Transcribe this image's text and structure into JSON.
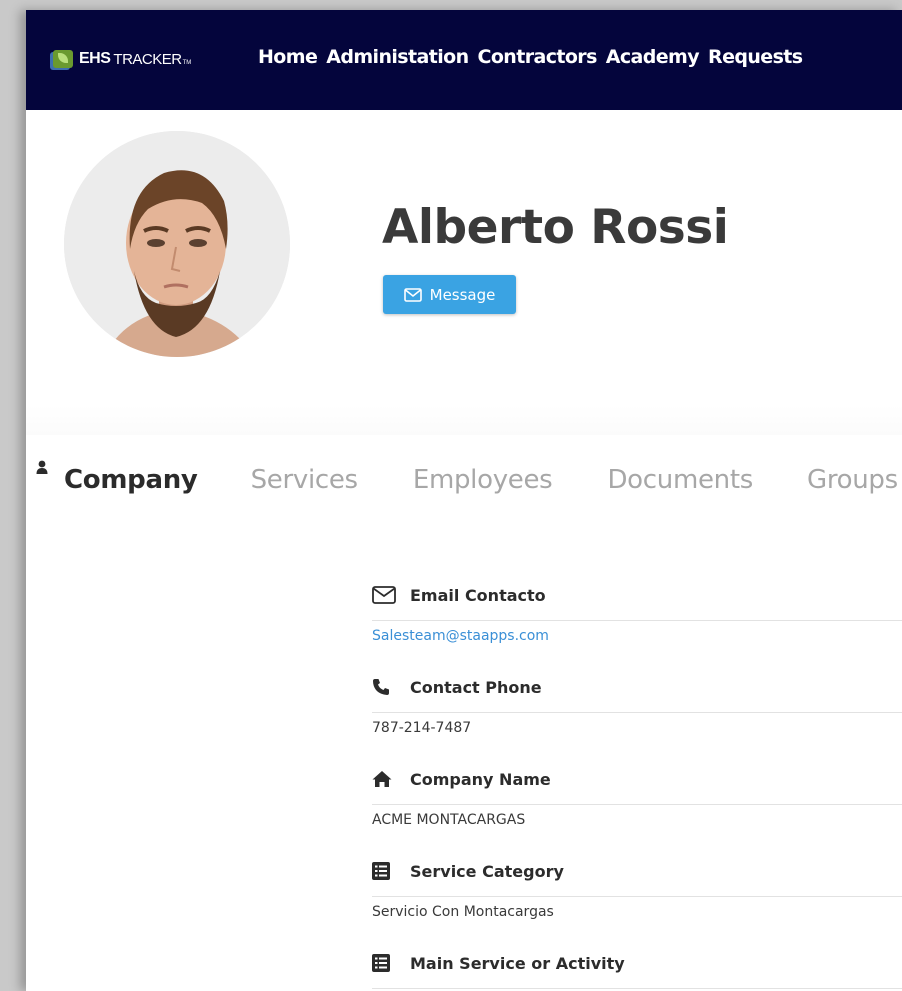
{
  "brand": {
    "ehs": "EHS",
    "tracker": "TRACKER",
    "tm": "TM"
  },
  "nav": [
    "Home",
    "Administation",
    "Contractors",
    "Academy",
    "Requests"
  ],
  "profile": {
    "name": "Alberto Rossi",
    "message_label": "Message"
  },
  "tabs": [
    "Company",
    "Services",
    "Employees",
    "Documents",
    "Groups"
  ],
  "fields": [
    {
      "icon": "envelope-icon",
      "label": "Email Contacto",
      "value": "Salesteam@staapps.com",
      "is_link": true
    },
    {
      "icon": "phone-icon",
      "label": "Contact Phone",
      "value": "787-214-7487",
      "is_link": false
    },
    {
      "icon": "home-icon",
      "label": "Company Name",
      "value": "ACME MONTACARGAS",
      "is_link": false
    },
    {
      "icon": "list-icon",
      "label": "Service Category",
      "value": "Servicio Con Montacargas",
      "is_link": false
    },
    {
      "icon": "list-icon",
      "label": "Main Service or Activity",
      "value": "",
      "is_link": false
    }
  ],
  "colors": {
    "navbar": "#04053c",
    "accent": "#3aa3e3",
    "link": "#3a8fd6"
  }
}
